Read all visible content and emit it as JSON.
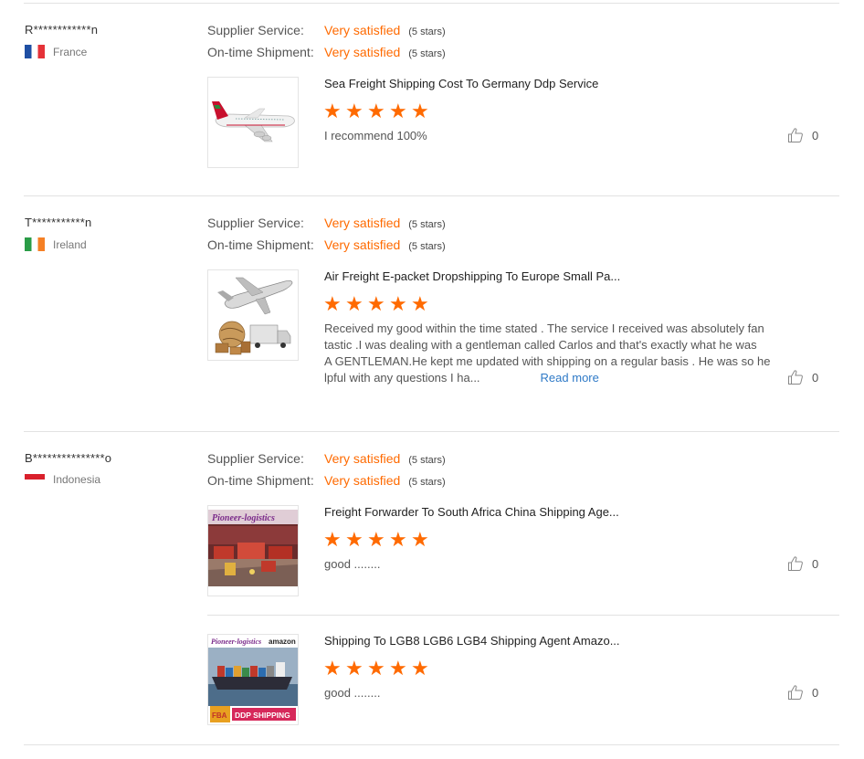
{
  "reviews": [
    {
      "buyer": "R************n",
      "country": "France",
      "supplier_service_label": "Supplier Service:",
      "supplier_service_value": "Very satisfied",
      "supplier_service_note": "(5 stars)",
      "shipment_label": "On-time Shipment:",
      "shipment_value": "Very satisfied",
      "shipment_note": "(5 stars)",
      "products": [
        {
          "title": "Sea Freight Shipping Cost To Germany Ddp Service",
          "stars": 5,
          "comment": "I recommend 100%",
          "likes": "0"
        }
      ]
    },
    {
      "buyer": "T***********n",
      "country": "Ireland",
      "supplier_service_label": "Supplier Service:",
      "supplier_service_value": "Very satisfied",
      "supplier_service_note": "(5 stars)",
      "shipment_label": "On-time Shipment:",
      "shipment_value": "Very satisfied",
      "shipment_note": "(5 stars)",
      "products": [
        {
          "title": "Air Freight E-packet Dropshipping To Europe Small Pa...",
          "stars": 5,
          "comment_lines": [
            "Received my good within the time stated . The service I received was absolutely fan",
            "tastic .I was dealing with a gentleman called Carlos and that's exactly what he was",
            "A GENTLEMAN.He kept me updated with shipping on a regular basis . He was so he",
            "lpful with any questions I ha..."
          ],
          "read_more": "Read more",
          "likes": "0"
        }
      ]
    },
    {
      "buyer": "B***************o",
      "country": "Indonesia",
      "supplier_service_label": "Supplier Service:",
      "supplier_service_value": "Very satisfied",
      "supplier_service_note": "(5 stars)",
      "shipment_label": "On-time Shipment:",
      "shipment_value": "Very satisfied",
      "shipment_note": "(5 stars)",
      "products": [
        {
          "title": "Freight Forwarder To South Africa China Shipping Age...",
          "stars": 5,
          "comment": "good ........",
          "likes": "0",
          "image_text": {
            "brand": "Pioneer-logistics"
          }
        },
        {
          "title": "Shipping To LGB8 LGB6 LGB4 Shipping Agent Amazo...",
          "stars": 5,
          "comment": "good ........",
          "likes": "0",
          "image_text": {
            "brand": "Pioneer-logistics",
            "amazon": "amazon",
            "fba": "FBA",
            "ddp": "DDP SHIPPING"
          }
        }
      ]
    }
  ],
  "colors": {
    "accent": "#ff6a00",
    "link": "#2f7ac7",
    "divider": "#e2e2e2"
  },
  "icons": {
    "like": "thumbs-up-icon",
    "star": "star-icon"
  }
}
